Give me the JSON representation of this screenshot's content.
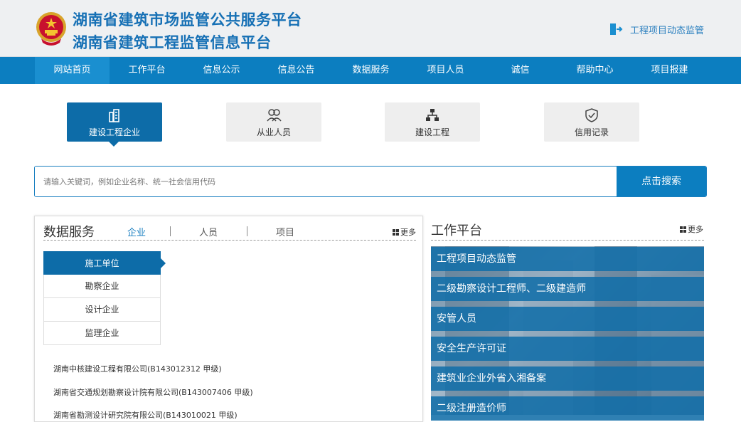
{
  "header": {
    "title1": "湖南省建筑市场监管公共服务平台",
    "title2": "湖南省建筑工程监管信息平台",
    "dynamic_link": "工程项目动态监管"
  },
  "nav": [
    "网站首页",
    "工作平台",
    "信息公示",
    "信息公告",
    "数据服务",
    "项目人员",
    "诚信",
    "帮助中心",
    "项目报建"
  ],
  "categories": [
    "建设工程企业",
    "从业人员",
    "建设工程",
    "信用记录"
  ],
  "search": {
    "placeholder": "请输入关键词，例如企业名称、统一社会信用代码",
    "button": "点击搜索"
  },
  "data_service": {
    "title": "数据服务",
    "tabs": [
      "企业",
      "人员",
      "项目"
    ],
    "more": "更多",
    "subnav": [
      "施工单位",
      "勘察企业",
      "设计企业",
      "监理企业"
    ],
    "companies": [
      "湖南中核建设工程有限公司(B143012312 甲级)",
      "湖南省交通规划勘察设计院有限公司(B143007406 甲级)",
      "湖南省勘测设计研究院有限公司(B143010021 甲级)"
    ]
  },
  "work_platform": {
    "title": "工作平台",
    "more": "更多",
    "items": [
      "工程项目动态监管",
      "二级勘察设计工程师、二级建造师",
      "安管人员",
      "安全生产许可证",
      "建筑业企业外省入湘备案",
      "二级注册造价师"
    ]
  },
  "colors": {
    "brand": "#0c7ec0",
    "title": "#1670b5",
    "active_card": "#0d6ca8"
  }
}
